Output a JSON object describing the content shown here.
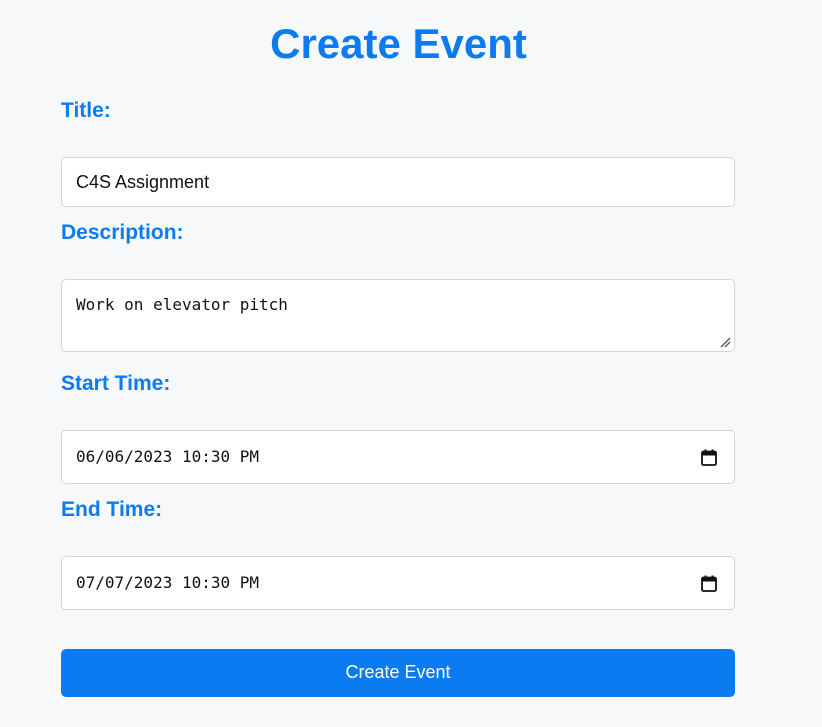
{
  "page": {
    "title": "Create Event"
  },
  "form": {
    "title_label": "Title:",
    "title_value": "C4S Assignment",
    "description_label": "Description:",
    "description_value": "Work on elevator pitch",
    "start_label": "Start Time:",
    "start_value": "06/06/2023 10:30 PM",
    "end_label": "End Time:",
    "end_value": "07/07/2023 10:30 PM",
    "submit_label": "Create Event"
  },
  "icons": {
    "start_picker": "calendar-icon",
    "end_picker": "calendar-icon",
    "description_resize": "resize-grip-icon"
  },
  "colors": {
    "accent": "#0b7bf2",
    "background": "#f7f8fa",
    "field_border": "#d3d6da"
  }
}
